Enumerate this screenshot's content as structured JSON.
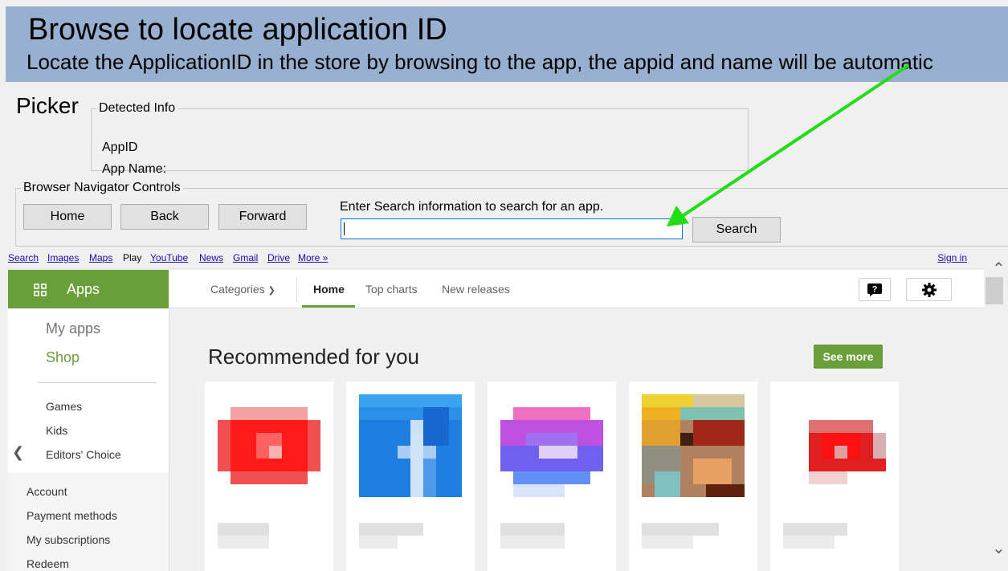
{
  "header": {
    "title": "Browse to locate application ID",
    "subtitle": "Locate the ApplicationID in the store by browsing to the app, the appid and name will be automatic"
  },
  "picker": {
    "label": "Picker",
    "detected_info": {
      "legend": "Detected Info",
      "appid_label": "AppID",
      "appname_label": "App Name:"
    }
  },
  "nav_controls": {
    "legend": "Browser Navigator Controls",
    "home": "Home",
    "back": "Back",
    "forward": "Forward",
    "search_prompt": "Enter Search information to search for an app.",
    "search_value": "",
    "search_button": "Search"
  },
  "browser": {
    "gbar": {
      "links": [
        "Search",
        "Images",
        "Maps"
      ],
      "current": "Play",
      "links2": [
        "YouTube",
        "News",
        "Gmail",
        "Drive",
        "More »"
      ],
      "sign_in": "Sign in"
    },
    "apps_tab": "Apps",
    "topnav": {
      "categories": "Categories",
      "home": "Home",
      "top_charts": "Top charts",
      "new_releases": "New releases"
    },
    "sidebar": {
      "my_apps": "My apps",
      "shop": "Shop",
      "games": "Games",
      "kids": "Kids",
      "editors_choice": "Editors' Choice",
      "account": "Account",
      "payment_methods": "Payment methods",
      "my_subscriptions": "My subscriptions",
      "redeem": "Redeem"
    },
    "section_title": "Recommended for you",
    "see_more": "See more",
    "colors": {
      "accent": "#689f38",
      "banner": "#97b0d0",
      "arrow": "#22dd11"
    }
  }
}
